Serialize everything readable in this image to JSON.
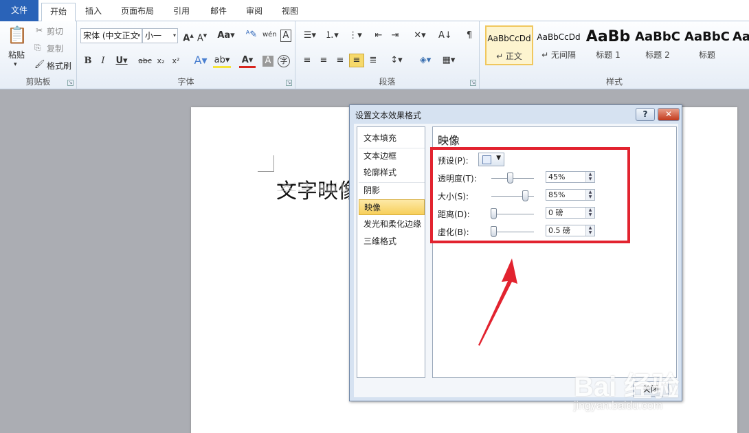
{
  "tabs": [
    "文件",
    "开始",
    "插入",
    "页面布局",
    "引用",
    "邮件",
    "审阅",
    "视图"
  ],
  "clipboard": {
    "paste": "粘贴",
    "cut": "剪切",
    "copy": "复制",
    "format_painter": "格式刷",
    "label": "剪贴板"
  },
  "font": {
    "name": "宋体 (中文正文",
    "size": "小一",
    "label": "字体"
  },
  "paragraph": {
    "label": "段落"
  },
  "styles": {
    "label": "样式",
    "items": [
      {
        "preview": "AaBbCcDd",
        "name": "↵ 正文"
      },
      {
        "preview": "AaBbCcDd",
        "name": "↵ 无间隔"
      },
      {
        "preview": "AaBb",
        "name": "标题 1"
      },
      {
        "preview": "AaBbC",
        "name": "标题 2"
      },
      {
        "preview": "AaBbC",
        "name": "标题"
      },
      {
        "preview": "Aa",
        "name": ""
      }
    ]
  },
  "document": {
    "text": "文字映像"
  },
  "dialog": {
    "title": "设置文本效果格式",
    "help": "?",
    "close_x": "✕",
    "nav": [
      "文本填充",
      "文本边框",
      "轮廓样式",
      "阴影",
      "映像",
      "发光和柔化边缘",
      "三维格式"
    ],
    "selected_nav": "映像",
    "panel_title": "映像",
    "preset_label": "预设(P):",
    "rows": [
      {
        "label": "透明度(T):",
        "value": "45%",
        "level": 0.45
      },
      {
        "label": "大小(S):",
        "value": "85%",
        "level": 0.85
      },
      {
        "label": "距离(D):",
        "value": "0 磅",
        "level": 0.0
      },
      {
        "label": "虚化(B):",
        "value": "0.5 磅",
        "level": 0.0
      }
    ],
    "close_button": "关闭"
  },
  "watermark": {
    "main": "Bai 经验",
    "url": "jingyan.baidu.com"
  },
  "colors": {
    "file_tab": "#2a63b8",
    "annotation_red": "#e2232f",
    "selection": "#f7cf5a"
  }
}
